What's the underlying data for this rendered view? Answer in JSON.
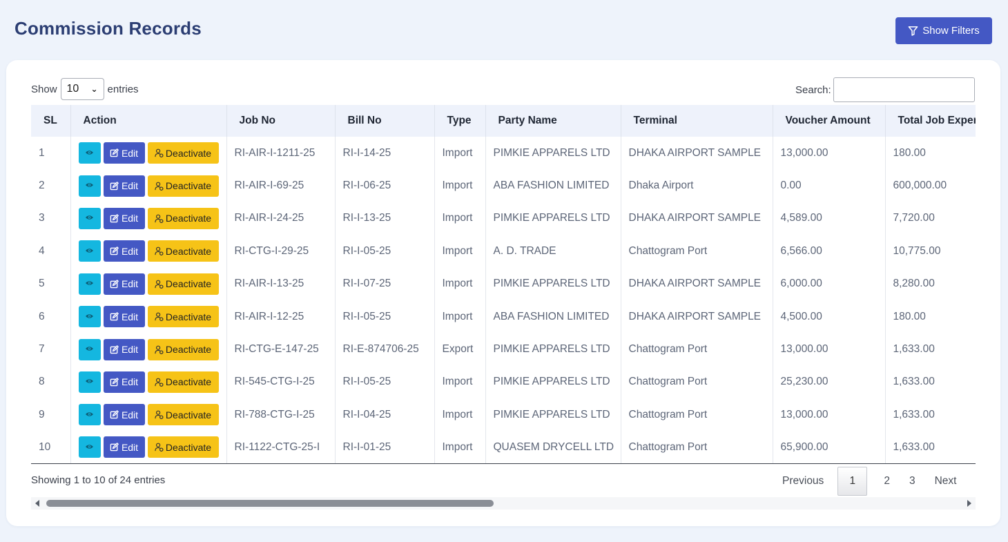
{
  "header": {
    "title": "Commission Records",
    "filter_button_label": "Show Filters"
  },
  "length_control": {
    "prefix": "Show",
    "selected": "10",
    "suffix": "entries"
  },
  "search": {
    "label": "Search:",
    "value": ""
  },
  "table": {
    "columns": [
      "SL",
      "Action",
      "Job No",
      "Bill No",
      "Type",
      "Party Name",
      "Terminal",
      "Voucher Amount",
      "Total Job Expen"
    ],
    "action_labels": {
      "edit": "Edit",
      "deactivate": "Deactivate"
    },
    "rows": [
      {
        "sl": "1",
        "job_no": "RI-AIR-I-1211-25",
        "bill_no": "RI-I-14-25",
        "type": "Import",
        "party": "PIMKIE APPARELS LTD",
        "terminal": "DHAKA AIRPORT SAMPLE",
        "voucher": "13,000.00",
        "expense": "180.00"
      },
      {
        "sl": "2",
        "job_no": "RI-AIR-I-69-25",
        "bill_no": "RI-I-06-25",
        "type": "Import",
        "party": "ABA FASHION LIMITED",
        "terminal": "Dhaka Airport",
        "voucher": "0.00",
        "expense": "600,000.00"
      },
      {
        "sl": "3",
        "job_no": "RI-AIR-I-24-25",
        "bill_no": "RI-I-13-25",
        "type": "Import",
        "party": "PIMKIE APPARELS LTD",
        "terminal": "DHAKA AIRPORT SAMPLE",
        "voucher": "4,589.00",
        "expense": "7,720.00"
      },
      {
        "sl": "4",
        "job_no": "RI-CTG-I-29-25",
        "bill_no": "RI-I-05-25",
        "type": "Import",
        "party": "A. D. TRADE",
        "terminal": "Chattogram Port",
        "voucher": "6,566.00",
        "expense": "10,775.00"
      },
      {
        "sl": "5",
        "job_no": "RI-AIR-I-13-25",
        "bill_no": "RI-I-07-25",
        "type": "Import",
        "party": "PIMKIE APPARELS LTD",
        "terminal": "DHAKA AIRPORT SAMPLE",
        "voucher": "6,000.00",
        "expense": "8,280.00"
      },
      {
        "sl": "6",
        "job_no": "RI-AIR-I-12-25",
        "bill_no": "RI-I-05-25",
        "type": "Import",
        "party": "ABA FASHION LIMITED",
        "terminal": "DHAKA AIRPORT SAMPLE",
        "voucher": "4,500.00",
        "expense": "180.00"
      },
      {
        "sl": "7",
        "job_no": "RI-CTG-E-147-25",
        "bill_no": "RI-E-874706-25",
        "type": "Export",
        "party": "PIMKIE APPARELS LTD",
        "terminal": "Chattogram Port",
        "voucher": "13,000.00",
        "expense": "1,633.00"
      },
      {
        "sl": "8",
        "job_no": "RI-545-CTG-I-25",
        "bill_no": "RI-I-05-25",
        "type": "Import",
        "party": "PIMKIE APPARELS LTD",
        "terminal": "Chattogram Port",
        "voucher": "25,230.00",
        "expense": "1,633.00"
      },
      {
        "sl": "9",
        "job_no": "RI-788-CTG-I-25",
        "bill_no": "RI-I-04-25",
        "type": "Import",
        "party": "PIMKIE APPARELS LTD",
        "terminal": "Chattogram Port",
        "voucher": "13,000.00",
        "expense": "1,633.00"
      },
      {
        "sl": "10",
        "job_no": "RI-1122-CTG-25-I",
        "bill_no": "RI-I-01-25",
        "type": "Import",
        "party": "QUASEM DRYCELL LTD",
        "terminal": "Chattogram Port",
        "voucher": "65,900.00",
        "expense": "1,633.00"
      }
    ]
  },
  "footer": {
    "info": "Showing 1 to 10 of 24 entries",
    "previous": "Previous",
    "pages": [
      "1",
      "2",
      "3"
    ],
    "active_page": "1",
    "next": "Next"
  },
  "colors": {
    "primary": "#4458c4",
    "info": "#14b7e0",
    "warning": "#f6c317",
    "title": "#2c3e73"
  },
  "icons": {
    "filter": "filter-icon",
    "view": "eye-icon",
    "edit": "edit-icon",
    "deactivate": "user-deactivate-icon"
  }
}
